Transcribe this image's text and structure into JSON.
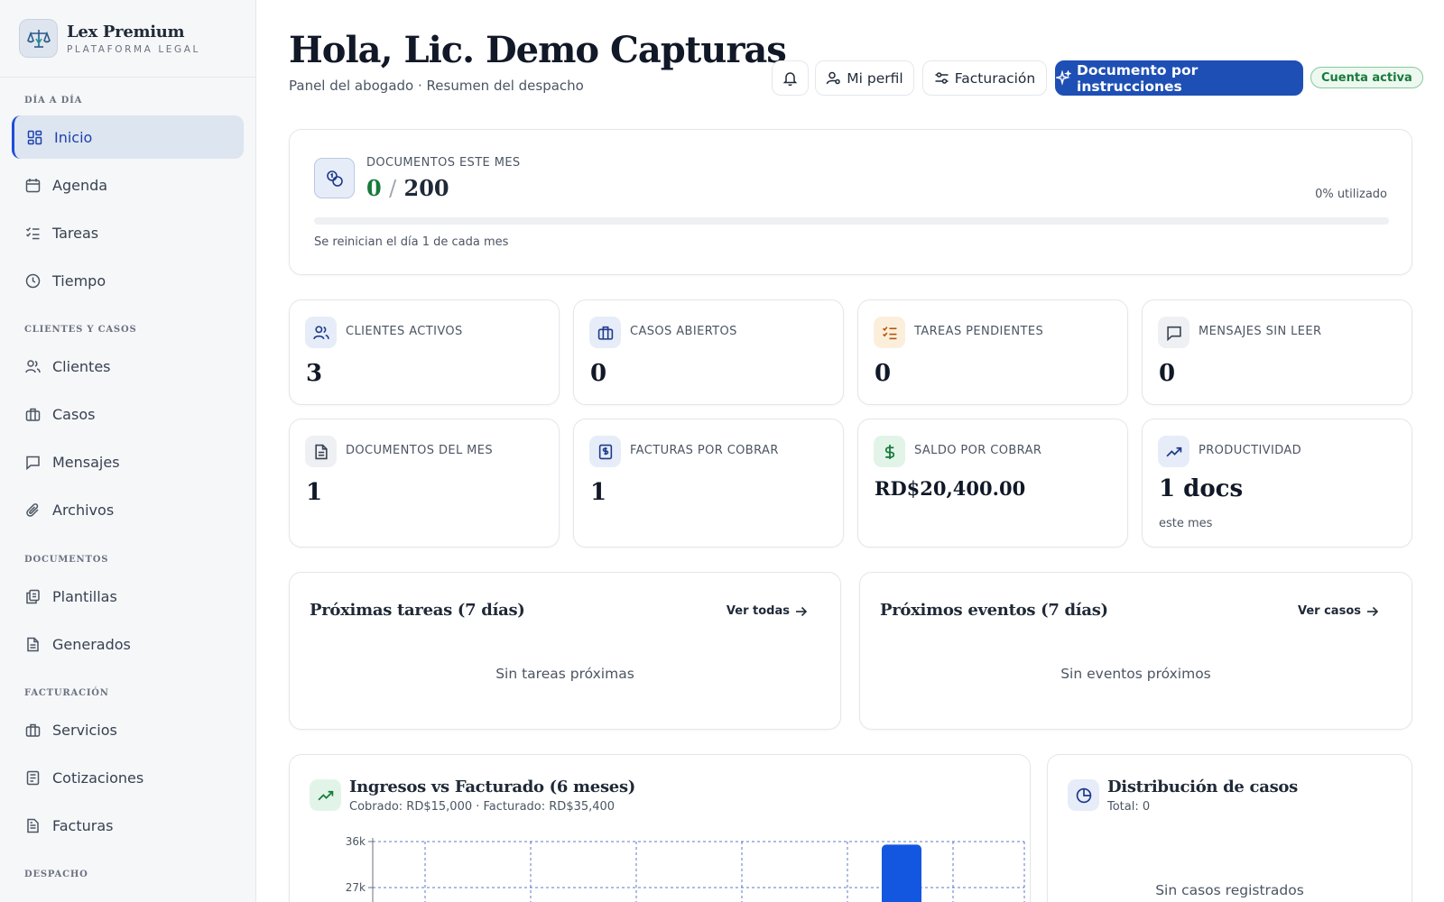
{
  "brand": {
    "name": "Lex Premium",
    "subtitle": "PLATAFORMA LEGAL"
  },
  "sidebar": {
    "sections": [
      {
        "label": "DÍA A DÍA"
      },
      {
        "label": "CLIENTES Y CASOS"
      },
      {
        "label": "DOCUMENTOS"
      },
      {
        "label": "FACTURACIÓN"
      },
      {
        "label": "DESPACHO"
      }
    ],
    "items": [
      {
        "label": "Inicio",
        "icon": "grid-icon",
        "active": true
      },
      {
        "label": "Agenda",
        "icon": "calendar-icon"
      },
      {
        "label": "Tareas",
        "icon": "checklist-icon"
      },
      {
        "label": "Tiempo",
        "icon": "clock-icon"
      },
      {
        "label": "Clientes",
        "icon": "users-icon"
      },
      {
        "label": "Casos",
        "icon": "briefcase-icon"
      },
      {
        "label": "Mensajes",
        "icon": "message-icon"
      },
      {
        "label": "Archivos",
        "icon": "paperclip-icon"
      },
      {
        "label": "Plantillas",
        "icon": "templates-icon"
      },
      {
        "label": "Generados",
        "icon": "document-icon"
      },
      {
        "label": "Servicios",
        "icon": "briefcase-icon"
      },
      {
        "label": "Cotizaciones",
        "icon": "receipt-icon"
      },
      {
        "label": "Facturas",
        "icon": "invoice-icon"
      }
    ]
  },
  "header": {
    "greeting": "Hola, Lic. Demo Capturas",
    "subtitle": "Panel del abogado · Resumen del despacho",
    "profile_label": "Mi perfil",
    "billing_label": "Facturación",
    "primary_label": "Documento por instrucciones",
    "status_badge": "Cuenta activa"
  },
  "usage": {
    "label": "DOCUMENTOS ESTE MES",
    "used": "0",
    "separator": "/",
    "limit": "200",
    "percent_text": "0% utilizado",
    "percent": 0,
    "note": "Se reinician el día 1 de cada mes"
  },
  "stats": [
    {
      "label": "CLIENTES ACTIVOS",
      "value": "3",
      "icon": "users-icon"
    },
    {
      "label": "CASOS ABIERTOS",
      "value": "0",
      "icon": "briefcase-icon"
    },
    {
      "label": "TAREAS PENDIENTES",
      "value": "0",
      "icon": "checklist-icon"
    },
    {
      "label": "MENSAJES SIN LEER",
      "value": "0",
      "icon": "message-icon"
    },
    {
      "label": "DOCUMENTOS DEL MES",
      "value": "1",
      "icon": "document-icon"
    },
    {
      "label": "FACTURAS POR COBRAR",
      "value": "1",
      "icon": "invoice-icon"
    },
    {
      "label": "SALDO POR COBRAR",
      "value": "RD$20,400.00",
      "icon": "dollar-icon"
    },
    {
      "label": "PRODUCTIVIDAD",
      "value": "1 docs",
      "sub": "este mes",
      "icon": "trending-up-icon"
    }
  ],
  "tasks_panel": {
    "title": "Próximas tareas (7 días)",
    "link": "Ver todas",
    "empty": "Sin tareas próximas"
  },
  "events_panel": {
    "title": "Próximos eventos (7 días)",
    "link": "Ver casos",
    "empty": "Sin eventos próximos"
  },
  "income_panel": {
    "title": "Ingresos vs Facturado (6 meses)",
    "subtitle": "Cobrado: RD$15,000 · Facturado: RD$35,400"
  },
  "cases_panel": {
    "title": "Distribución de casos",
    "subtitle": "Total: 0",
    "empty": "Sin casos registrados"
  },
  "chart_data": {
    "type": "bar",
    "yticks": [
      "36k",
      "27k"
    ],
    "ylim": [
      0,
      36000
    ],
    "series": [
      {
        "values": [
          0,
          0,
          0,
          0,
          0,
          35400
        ]
      }
    ]
  },
  "colors": {
    "accent": "#1e4fb5",
    "success": "#177a3a",
    "bar": "#1357e0"
  }
}
